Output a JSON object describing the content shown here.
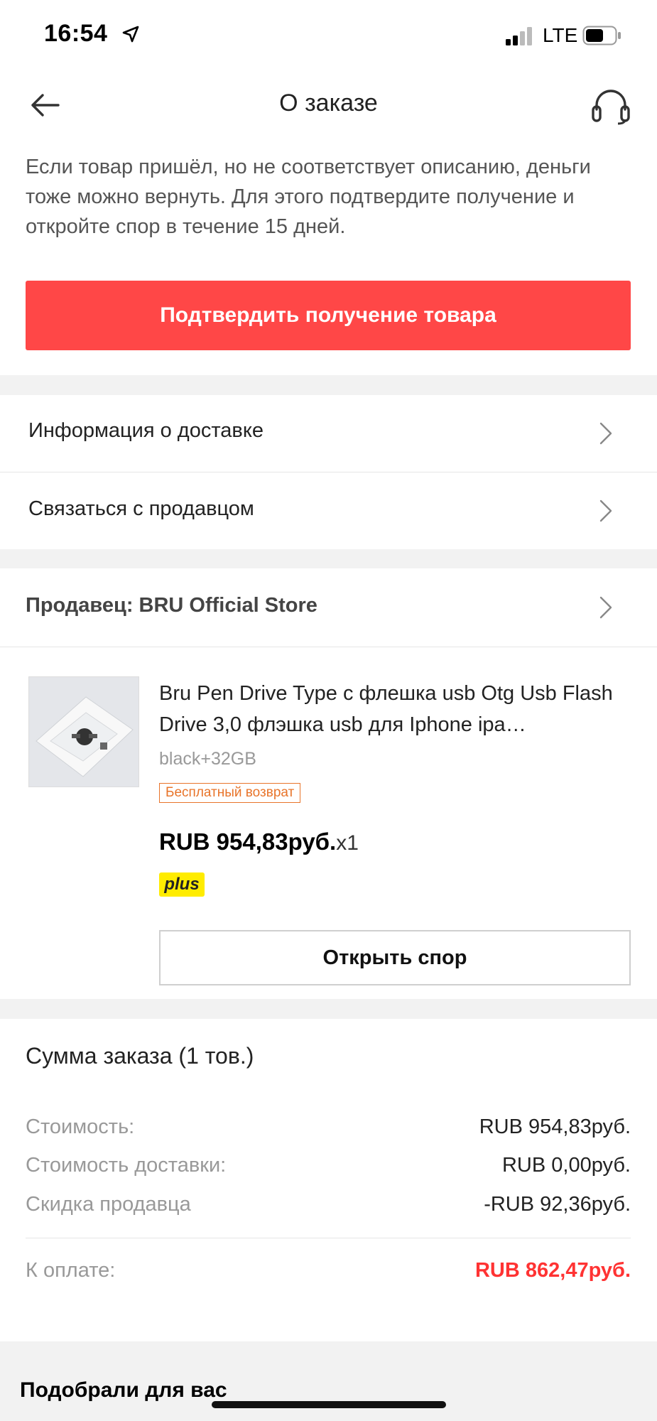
{
  "status_bar": {
    "time": "16:54",
    "network": "LTE"
  },
  "header": {
    "title": "О заказе"
  },
  "notice": {
    "text": "Если товар пришёл, но не соответствует описанию, деньги тоже можно вернуть. Для этого подтвердите получение и откройте спор в течение 15 дней.",
    "confirm_button": "Подтвердить получение товара"
  },
  "rows": {
    "delivery_info": "Информация о доставке",
    "contact_seller": "Связаться с продавцом"
  },
  "seller": {
    "label": "Продавец: BRU Official Store"
  },
  "product": {
    "title": "Bru Pen Drive Type с флешка usb Otg Usb Flash Drive 3,0 флэшка usb для Iphone ipa…",
    "variant": "black+32GB",
    "return_badge": "Бесплатный возврат",
    "price": "RUB 954,83руб.",
    "quantity": "x1",
    "plus_badge": "plus",
    "dispute_button": "Открыть спор"
  },
  "summary": {
    "title": "Сумма заказа (1 тов.)",
    "cost_label": "Стоимость:",
    "cost_value": "RUB 954,83руб.",
    "shipping_label": "Стоимость доставки:",
    "shipping_value": "RUB 0,00руб.",
    "discount_label": "Скидка продавца",
    "discount_value": "-RUB 92,36руб.",
    "total_label": "К оплате:",
    "total_value": "RUB 862,47руб.",
    "total_color": "#ff3333"
  },
  "recommendations": {
    "title": "Подобрали для вас"
  },
  "colors": {
    "accent": "#ff4747",
    "badge_orange": "#e8742a",
    "plus_yellow": "#ffec00"
  }
}
